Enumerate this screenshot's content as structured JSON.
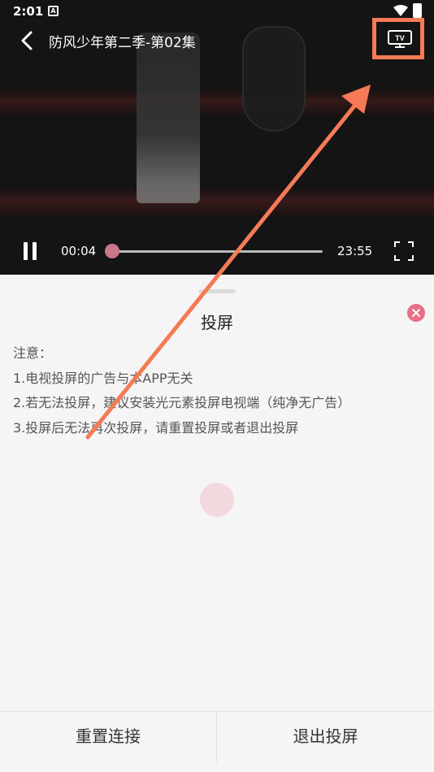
{
  "status_bar": {
    "time": "2:01",
    "notification_icon": "A"
  },
  "player": {
    "title": "防风少年第二季-第02集",
    "current_time": "00:04",
    "total_time": "23:55",
    "progress": 0.003,
    "cast_button_label": "TV",
    "accent_color": "#c8788a"
  },
  "sheet": {
    "title": "投屏",
    "notice_lines": [
      "注意：",
      "1.电视投屏的广告与本APP无关",
      "2.若无法投屏，建议安装光元素投屏电视端（纯净无广告）",
      "3.投屏后无法再次投屏，请重置投屏或者退出投屏"
    ],
    "close_color": "#e86e84"
  },
  "bottom_bar": {
    "reset_label": "重置连接",
    "exit_label": "退出投屏"
  },
  "annotation": {
    "highlight_color": "#f47b55"
  }
}
